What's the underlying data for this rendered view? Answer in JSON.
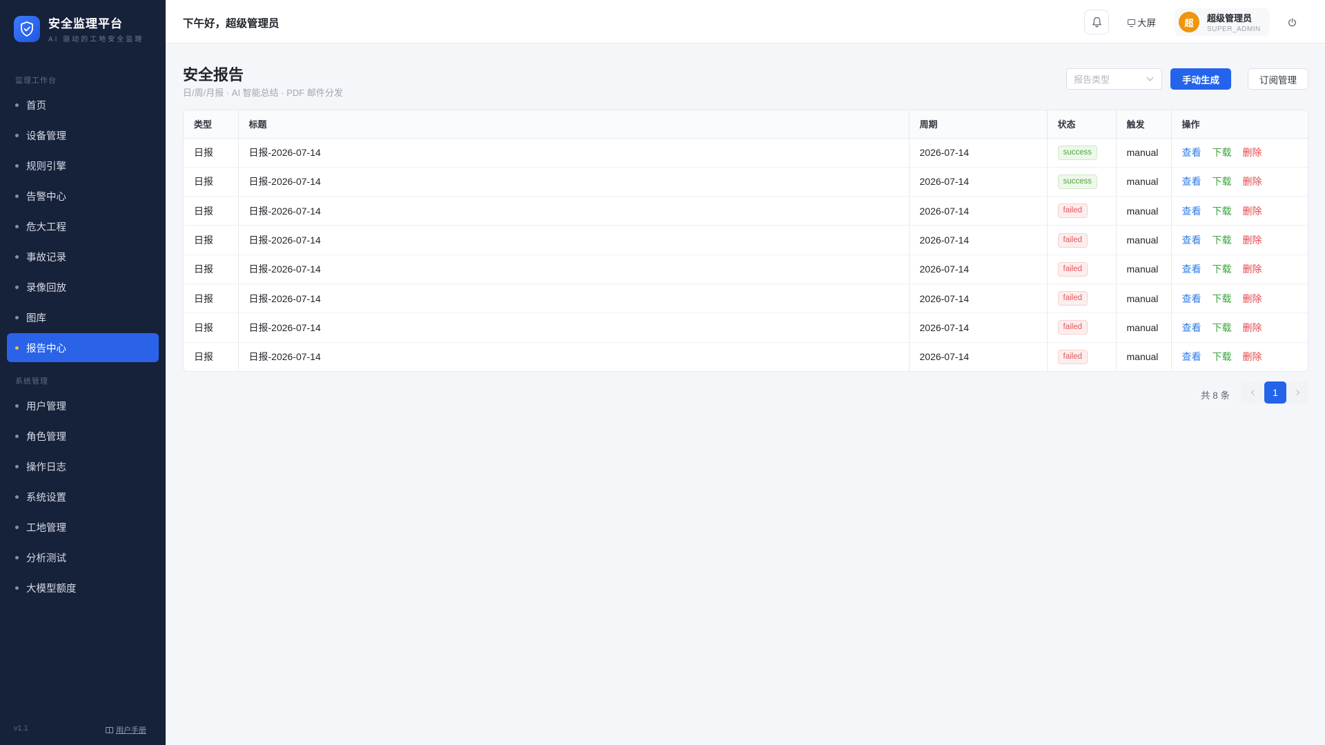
{
  "brand": {
    "title": "安全监理平台",
    "subtitle": "AI 驱动的工地安全监理",
    "accent": "#2a63e8"
  },
  "sidebar": {
    "section_work": "监理工作台",
    "work_items": [
      {
        "label": "首页",
        "active": false
      },
      {
        "label": "设备管理",
        "active": false
      },
      {
        "label": "规则引擎",
        "active": false
      },
      {
        "label": "告警中心",
        "active": false
      },
      {
        "label": "危大工程",
        "active": false
      },
      {
        "label": "事故记录",
        "active": false
      },
      {
        "label": "录像回放",
        "active": false
      },
      {
        "label": "图库",
        "active": false
      },
      {
        "label": "报告中心",
        "active": true
      }
    ],
    "section_system": "系统管理",
    "system_items": [
      {
        "label": "用户管理"
      },
      {
        "label": "角色管理"
      },
      {
        "label": "操作日志"
      },
      {
        "label": "系统设置"
      },
      {
        "label": "工地管理"
      },
      {
        "label": "分析测试"
      },
      {
        "label": "大模型额度"
      }
    ],
    "version": "v1.1",
    "manual_link": "用户手册"
  },
  "header": {
    "greeting": "下午好，超级管理员",
    "screen_label": "大屏",
    "user": {
      "avatar_text": "超",
      "name": "超级管理员",
      "role": "SUPER_ADMIN"
    }
  },
  "page": {
    "title": "安全报告",
    "subtitle": "日/周/月报 · AI 智能总结 · PDF 邮件分发",
    "type_select_placeholder": "报告类型",
    "generate_button": "手动生成",
    "subscribe_button": "订阅管理"
  },
  "table": {
    "columns": [
      "类型",
      "标题",
      "周期",
      "状态",
      "触发",
      "操作"
    ],
    "actions": {
      "view": "查看",
      "download": "下载",
      "delete": "删除"
    },
    "rows": [
      {
        "type": "日报",
        "title": "日报-2026-07-14",
        "period": "2026-07-14",
        "status": "success",
        "trigger": "manual"
      },
      {
        "type": "日报",
        "title": "日报-2026-07-14",
        "period": "2026-07-14",
        "status": "success",
        "trigger": "manual"
      },
      {
        "type": "日报",
        "title": "日报-2026-07-14",
        "period": "2026-07-14",
        "status": "failed",
        "trigger": "manual"
      },
      {
        "type": "日报",
        "title": "日报-2026-07-14",
        "period": "2026-07-14",
        "status": "failed",
        "trigger": "manual"
      },
      {
        "type": "日报",
        "title": "日报-2026-07-14",
        "period": "2026-07-14",
        "status": "failed",
        "trigger": "manual"
      },
      {
        "type": "日报",
        "title": "日报-2026-07-14",
        "period": "2026-07-14",
        "status": "failed",
        "trigger": "manual"
      },
      {
        "type": "日报",
        "title": "日报-2026-07-14",
        "period": "2026-07-14",
        "status": "failed",
        "trigger": "manual"
      },
      {
        "type": "日报",
        "title": "日报-2026-07-14",
        "period": "2026-07-14",
        "status": "failed",
        "trigger": "manual"
      }
    ]
  },
  "pagination": {
    "total_label": "共 8 条",
    "current_page": "1"
  }
}
